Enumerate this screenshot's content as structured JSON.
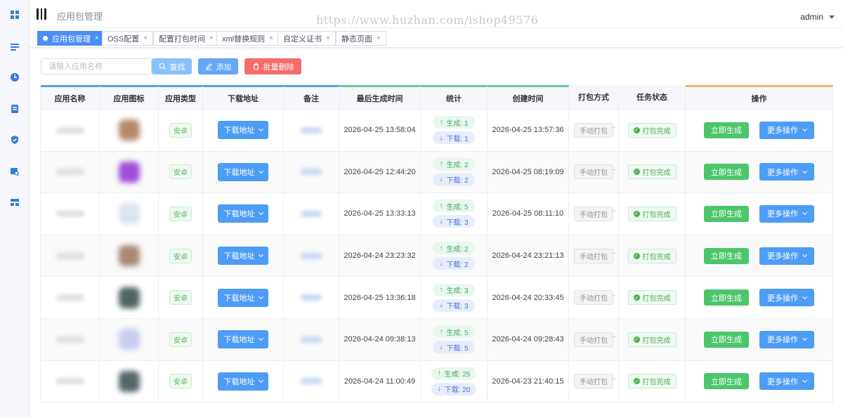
{
  "navbar": {
    "page_title": "应用包管理",
    "watermark": "https://www.huzhan.com/ishop49576",
    "user": "admin"
  },
  "sidebar": {
    "items": [
      {
        "icon": "dashboard-icon"
      },
      {
        "icon": "list-icon"
      },
      {
        "icon": "clock-icon"
      },
      {
        "icon": "document-icon"
      },
      {
        "icon": "shield-icon"
      },
      {
        "icon": "search-doc-icon"
      },
      {
        "icon": "layout-icon"
      }
    ]
  },
  "tabs": [
    {
      "label": "应用包管理",
      "close": "×",
      "active": true
    },
    {
      "label": "OSS配置",
      "close": "×"
    },
    {
      "label": "配置打包时间",
      "close": "×"
    },
    {
      "label": "xml替换规则",
      "close": "×"
    },
    {
      "label": "自定义证书",
      "close": "×"
    },
    {
      "label": "静态页面",
      "close": "×"
    }
  ],
  "toolbar": {
    "search_placeholder": "请输入应用名称",
    "search_label": "查找",
    "add_label": "添加",
    "batch_delete_label": "批量删除"
  },
  "table": {
    "headers": [
      "应用名称",
      "应用图标",
      "应用类型",
      "下载地址",
      "备注",
      "最后生成时间",
      "统计",
      "创建时间",
      "打包方式",
      "任务状态",
      "操作"
    ],
    "rows": [
      {
        "type": "安卓",
        "download": "下载地址",
        "last_gen": "2026-04-25 13:58:04",
        "gen": "生成: 1",
        "dl": "下载: 1",
        "created": "2026-04-25 13:57:36",
        "pack": "手动打包",
        "status": "打包完成",
        "gen_btn": "立即生成",
        "more": "更多操作",
        "icon_color": "#b58a6c"
      },
      {
        "type": "安卓",
        "download": "下载地址",
        "last_gen": "2026-04-25 12:44:20",
        "gen": "生成: 2",
        "dl": "下载: 2",
        "created": "2026-04-25 08:19:09",
        "pack": "手动打包",
        "status": "打包完成",
        "gen_btn": "立即生成",
        "more": "更多操作",
        "icon_color": "#a04ed6"
      },
      {
        "type": "安卓",
        "download": "下载地址",
        "last_gen": "2026-04-25 13:33:13",
        "gen": "生成: 5",
        "dl": "下载: 3",
        "created": "2026-04-25 08:11:10",
        "pack": "手动打包",
        "status": "打包完成",
        "gen_btn": "立即生成",
        "more": "更多操作",
        "icon_color": "#dbe4f1"
      },
      {
        "type": "安卓",
        "download": "下载地址",
        "last_gen": "2026-04-24 23:23:32",
        "gen": "生成: 2",
        "dl": "下载: 2",
        "created": "2026-04-24 23:21:13",
        "pack": "手动打包",
        "status": "打包完成",
        "gen_btn": "立即生成",
        "more": "更多操作",
        "icon_color": "#a98a78"
      },
      {
        "type": "安卓",
        "download": "下载地址",
        "last_gen": "2026-04-25 13:36:18",
        "gen": "生成: 3",
        "dl": "下载: 3",
        "created": "2026-04-24 20:33:45",
        "pack": "手动打包",
        "status": "打包完成",
        "gen_btn": "立即生成",
        "more": "更多操作",
        "icon_color": "#4f6463"
      },
      {
        "type": "安卓",
        "download": "下载地址",
        "last_gen": "2026-04-24 09:38:13",
        "gen": "生成: 5",
        "dl": "下载: 5",
        "created": "2026-04-24 09:28:43",
        "pack": "手动打包",
        "status": "打包完成",
        "gen_btn": "立即生成",
        "more": "更多操作",
        "icon_color": "#c8ccee"
      },
      {
        "type": "安卓",
        "download": "下载地址",
        "last_gen": "2026-04-24 11:00:49",
        "gen": "生成: 25",
        "dl": "下载: 20",
        "created": "2026-04-23 21:40:15",
        "pack": "手动打包",
        "status": "打包完成",
        "gen_btn": "立即生成",
        "more": "更多操作",
        "icon_color": "#56676a"
      }
    ]
  }
}
